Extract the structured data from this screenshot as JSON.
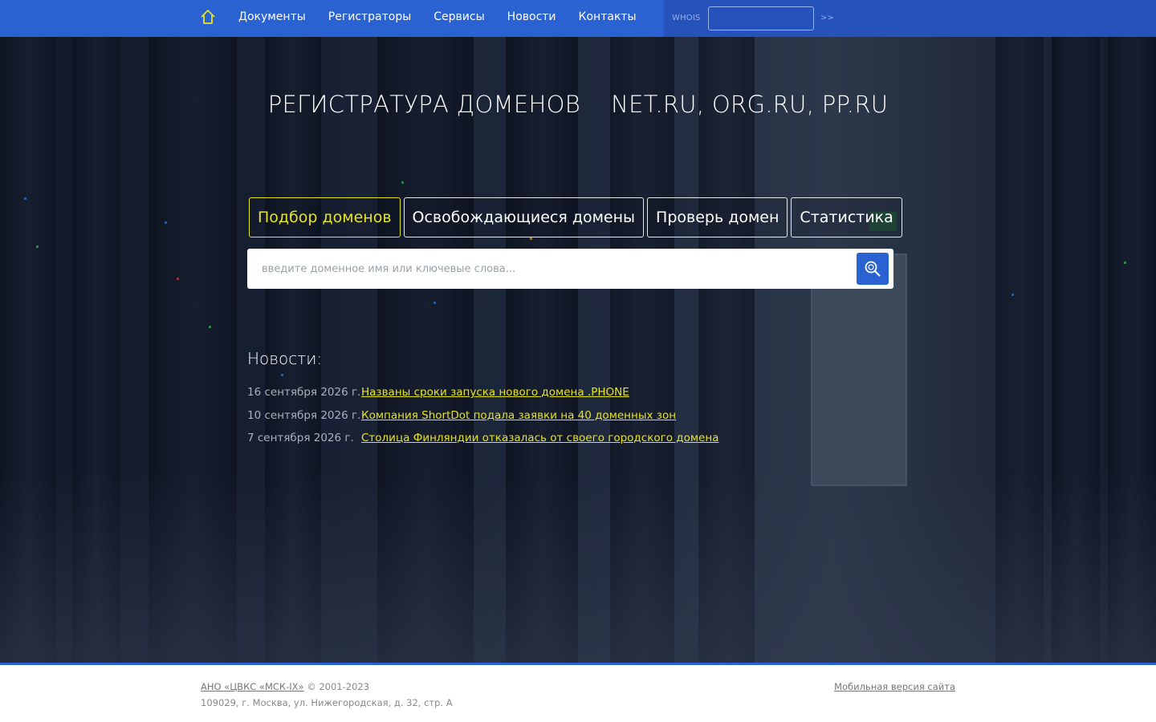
{
  "nav": {
    "items": [
      {
        "label": "Документы"
      },
      {
        "label": "Регистраторы"
      },
      {
        "label": "Сервисы"
      },
      {
        "label": "Новости"
      },
      {
        "label": "Контакты"
      }
    ],
    "whois_label": "WHOIS",
    "whois_value": "",
    "whois_go": ">>"
  },
  "hero": {
    "title": "РЕГИСТРАТУРА ДОМЕНОВ    NET.RU, ORG.RU, PP.RU"
  },
  "tabs": [
    {
      "label": "Подбор доменов",
      "active": true
    },
    {
      "label": "Освобождающиеся домены",
      "active": false
    },
    {
      "label": "Проверь домен",
      "active": false
    },
    {
      "label": "Статистика",
      "active": false
    }
  ],
  "search": {
    "placeholder": "введите доменное имя или ключевые слова...",
    "value": ""
  },
  "news": {
    "title": "Новости:",
    "items": [
      {
        "date": "16 сентября 2026 г.",
        "text": "Названы сроки запуска нового домена .PHONE"
      },
      {
        "date": "10 сентября 2026 г.",
        "text": "Компания ShortDot подала заявки на 40 доменных зон"
      },
      {
        "date": "7 сентября 2026 г.",
        "text": "Столица Финляндии отказалась от своего городского домена"
      }
    ]
  },
  "footer": {
    "org_link": "АНО «ЦВКС «МСК-IX»",
    "copyright": " © 2001-2023",
    "address": "109029, г. Москва, ул. Нижегородская, д. 32, стр. А",
    "mobile_link": "Мобильная версия сайта"
  },
  "colors": {
    "brand_blue": "#2a62d1",
    "accent_yellow": "#e6e322"
  }
}
